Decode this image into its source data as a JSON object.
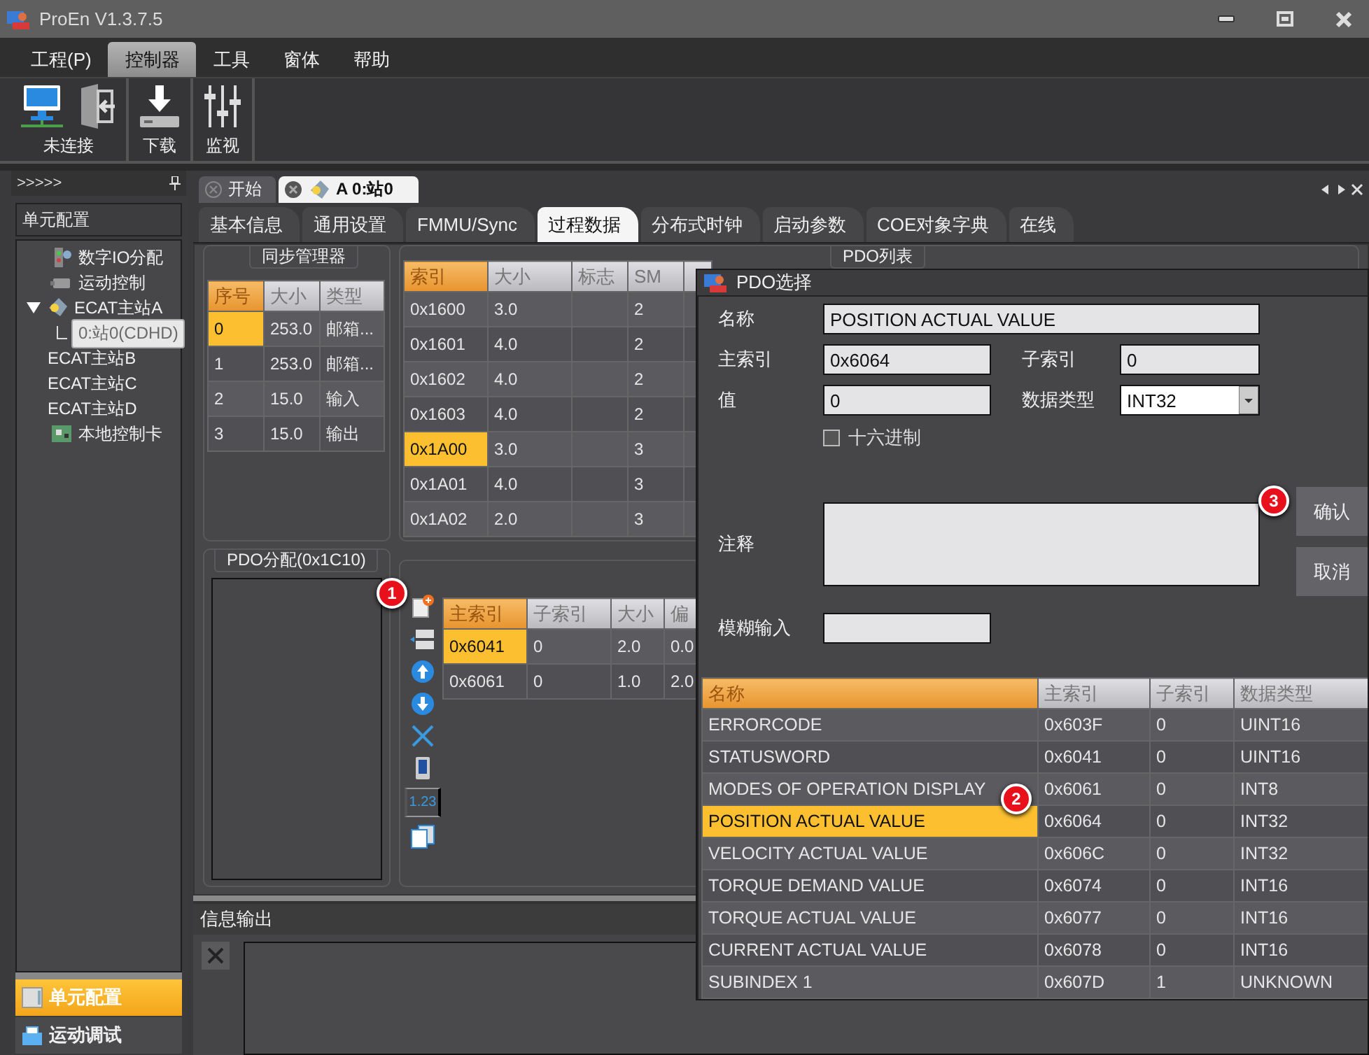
{
  "window": {
    "title": "ProEn V1.3.7.5"
  },
  "menu": [
    {
      "label": "工程(P)",
      "selected": false
    },
    {
      "label": "控制器",
      "selected": true
    },
    {
      "label": "工具",
      "selected": false
    },
    {
      "label": "窗体",
      "selected": false
    },
    {
      "label": "帮助",
      "selected": false
    }
  ],
  "ribbon": [
    {
      "label": "未连接"
    },
    {
      "label": "下载"
    },
    {
      "label": "监视"
    }
  ],
  "sidebar": {
    "header": ">>>>>",
    "title": "单元配置",
    "tree": [
      {
        "label": "数字IO分配",
        "selected": false
      },
      {
        "label": "运动控制",
        "selected": false
      },
      {
        "label": "ECAT主站A",
        "selected": false,
        "expanded": true,
        "children": [
          {
            "label": "0:站0(CDHD)",
            "selected": true
          }
        ]
      },
      {
        "label": "ECAT主站B",
        "selected": false
      },
      {
        "label": "ECAT主站C",
        "selected": false
      },
      {
        "label": "ECAT主站D",
        "selected": false
      },
      {
        "label": "本地控制卡",
        "selected": false
      }
    ],
    "bottom_tabs": [
      {
        "label": "单元配置",
        "selected": true
      },
      {
        "label": "运动调试",
        "selected": false
      }
    ]
  },
  "doc_tabs": [
    {
      "label": "开始",
      "selected": false
    },
    {
      "label": "A 0:站0",
      "selected": true
    }
  ],
  "sub_tabs": [
    {
      "label": "基本信息",
      "selected": false
    },
    {
      "label": "通用设置",
      "selected": false
    },
    {
      "label": "FMMU/Sync",
      "selected": false
    },
    {
      "label": "过程数据",
      "selected": true
    },
    {
      "label": "分布式时钟",
      "selected": false
    },
    {
      "label": "启动参数",
      "selected": false
    },
    {
      "label": "COE对象字典",
      "selected": false
    },
    {
      "label": "在线",
      "selected": false
    }
  ],
  "sync_manager": {
    "title": "同步管理器",
    "columns": [
      {
        "label": "序号",
        "sorted": true
      },
      {
        "label": "大小",
        "sorted": false
      },
      {
        "label": "类型",
        "sorted": false
      }
    ],
    "rows": [
      {
        "cells": [
          "0",
          "253.0",
          "邮箱..."
        ],
        "selected": true
      },
      {
        "cells": [
          "1",
          "253.0",
          "邮箱..."
        ],
        "selected": false
      },
      {
        "cells": [
          "2",
          "15.0",
          "输入"
        ],
        "selected": false
      },
      {
        "cells": [
          "3",
          "15.0",
          "输出"
        ],
        "selected": false
      }
    ]
  },
  "pdo_list": {
    "title": "PDO列表",
    "columns": [
      {
        "label": "索引",
        "sorted": true
      },
      {
        "label": "大小",
        "sorted": false
      },
      {
        "label": "标志",
        "sorted": false
      },
      {
        "label": "SM",
        "sorted": false
      }
    ],
    "rows": [
      {
        "cells": [
          "0x1600",
          "3.0",
          "",
          "2"
        ],
        "selected": false
      },
      {
        "cells": [
          "0x1601",
          "4.0",
          "",
          "2"
        ],
        "selected": false
      },
      {
        "cells": [
          "0x1602",
          "4.0",
          "",
          "2"
        ],
        "selected": false
      },
      {
        "cells": [
          "0x1603",
          "4.0",
          "",
          "2"
        ],
        "selected": false
      },
      {
        "cells": [
          "0x1A00",
          "3.0",
          "",
          "3"
        ],
        "selected": true
      },
      {
        "cells": [
          "0x1A01",
          "4.0",
          "",
          "3"
        ],
        "selected": false
      },
      {
        "cells": [
          "0x1A02",
          "2.0",
          "",
          "3"
        ],
        "selected": false
      }
    ]
  },
  "pdo_assign": {
    "title": "PDO分配(0x1C10)",
    "badge": "1"
  },
  "entries": {
    "toolbar_number": "1.23",
    "columns": [
      {
        "label": "主索引",
        "sorted": true
      },
      {
        "label": "子索引",
        "sorted": false
      },
      {
        "label": "大小",
        "sorted": false
      },
      {
        "label": "偏",
        "sorted": false
      }
    ],
    "rows": [
      {
        "cells": [
          "0x6041",
          "0",
          "2.0",
          "0.0"
        ],
        "selected": true
      },
      {
        "cells": [
          "0x6061",
          "0",
          "1.0",
          "2.0"
        ],
        "selected": false
      }
    ]
  },
  "info_output": {
    "title": "信息输出"
  },
  "dialog": {
    "title": "PDO选择",
    "name": {
      "label": "名称",
      "value": "POSITION ACTUAL VALUE"
    },
    "index": {
      "label": "主索引",
      "value": "0x6064"
    },
    "subindex": {
      "label": "子索引",
      "value": "0"
    },
    "value": {
      "label": "值",
      "value": "0"
    },
    "data_type": {
      "label": "数据类型",
      "value": "INT32"
    },
    "hex": {
      "label": "十六进制",
      "checked": false
    },
    "comment": {
      "label": "注释"
    },
    "fuzzy": {
      "label": "模糊输入"
    },
    "buttons": [
      {
        "label": "确认",
        "badge": "3"
      },
      {
        "label": "取消"
      }
    ],
    "columns": [
      {
        "label": "名称",
        "sorted": true
      },
      {
        "label": "主索引",
        "sorted": false
      },
      {
        "label": "子索引",
        "sorted": false
      },
      {
        "label": "数据类型",
        "sorted": false
      }
    ],
    "rows": [
      {
        "cells": [
          "ERRORCODE",
          "0x603F",
          "0",
          "UINT16"
        ],
        "selected": false
      },
      {
        "cells": [
          "STATUSWORD",
          "0x6041",
          "0",
          "UINT16"
        ],
        "selected": false
      },
      {
        "cells": [
          "MODES OF OPERATION DISPLAY",
          "0x6061",
          "0",
          "INT8"
        ],
        "selected": false
      },
      {
        "cells": [
          "POSITION ACTUAL VALUE",
          "0x6064",
          "0",
          "INT32"
        ],
        "selected": true,
        "badge": "2"
      },
      {
        "cells": [
          "VELOCITY ACTUAL VALUE",
          "0x606C",
          "0",
          "INT32"
        ],
        "selected": false
      },
      {
        "cells": [
          "TORQUE DEMAND VALUE",
          "0x6074",
          "0",
          "INT16"
        ],
        "selected": false
      },
      {
        "cells": [
          "TORQUE ACTUAL VALUE",
          "0x6077",
          "0",
          "INT16"
        ],
        "selected": false
      },
      {
        "cells": [
          "CURRENT ACTUAL VALUE",
          "0x6078",
          "0",
          "INT16"
        ],
        "selected": false
      },
      {
        "cells": [
          "SUBINDEX 1",
          "0x607D",
          "1",
          "UNKNOWN"
        ],
        "selected": false
      }
    ]
  }
}
